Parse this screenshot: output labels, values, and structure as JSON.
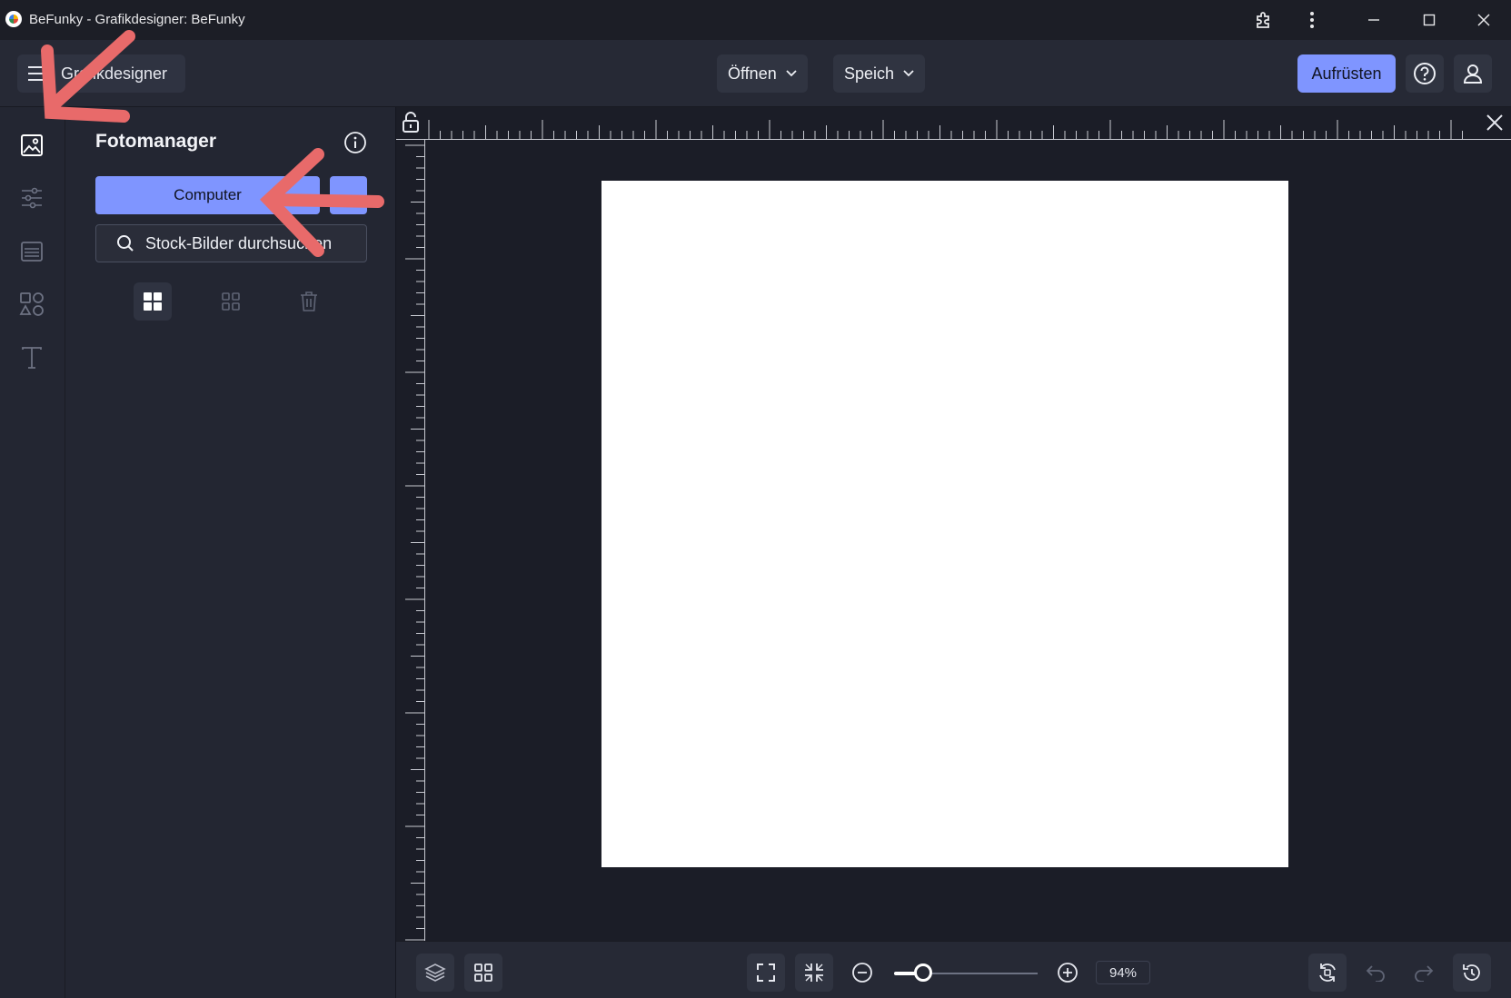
{
  "window": {
    "title": "BeFunky - Grafikdesigner: BeFunky",
    "icons": [
      "extension-icon",
      "more-vert-icon",
      "minimize-icon",
      "maximize-icon",
      "close-icon"
    ]
  },
  "header": {
    "menu_label": "Grafikdesigner",
    "open_label": "Öffnen",
    "save_label": "Speich",
    "upgrade_label": "Aufrüsten",
    "icons": [
      "hamburger-icon",
      "chevron-down-icon",
      "help-icon",
      "user-icon"
    ]
  },
  "rail": {
    "items": [
      "image-icon",
      "sliders-icon",
      "layout-icon",
      "shapes-icon",
      "text-icon"
    ]
  },
  "panel": {
    "title": "Fotomanager",
    "computer_label": "Computer",
    "stock_label": "Stock-Bilder durchsuchen",
    "views": [
      "grid-large-icon",
      "grid-small-icon",
      "trash-icon"
    ]
  },
  "zoom": {
    "value_text": "94",
    "unit": "%",
    "level": 0.2
  },
  "colors": {
    "accent": "#7f95ff",
    "background": "#1b1d27",
    "panel": "#232632",
    "annotation": "#e86a6a"
  }
}
